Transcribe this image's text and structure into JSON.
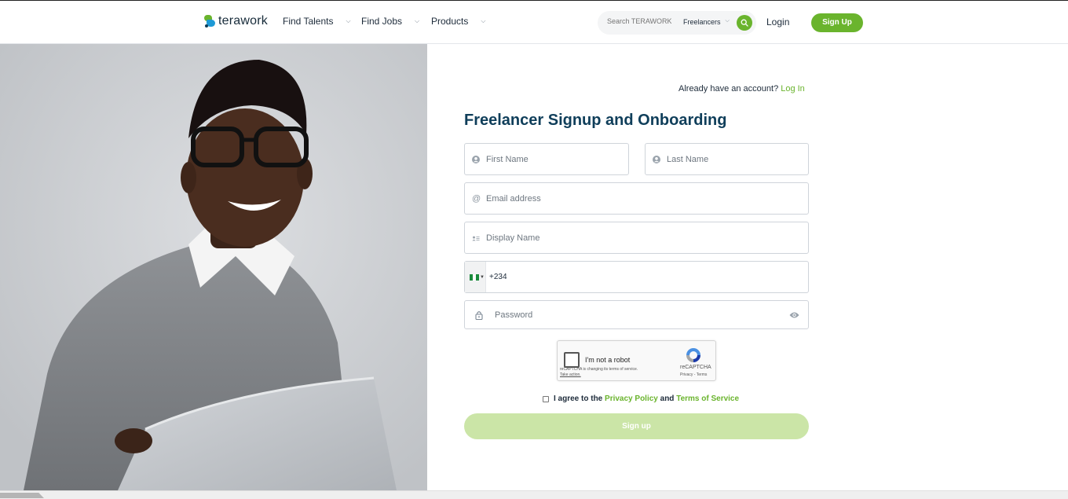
{
  "header": {
    "logo_text": "terawork",
    "nav": [
      {
        "label": "Find Talents"
      },
      {
        "label": "Find Jobs"
      },
      {
        "label": "Products"
      }
    ],
    "search": {
      "placeholder": "Search TERAWORK",
      "filter_value": "Freelancers"
    },
    "login_label": "Login",
    "signup_label": "Sign Up"
  },
  "form": {
    "have_account_text": "Already have an account?",
    "login_link": "Log In",
    "title": "Freelancer Signup and Onboarding",
    "first_name_placeholder": "First Name",
    "last_name_placeholder": "Last Name",
    "email_placeholder": "Email address",
    "display_name_placeholder": "Display Name",
    "phone_value": "+234",
    "password_placeholder": "Password",
    "captcha": {
      "label": "I'm not a robot",
      "notice": "reCAPTCHA is changing its terms of service.",
      "action": "Take action.",
      "brand": "reCAPTCHA",
      "links": "Privacy - Terms"
    },
    "agree": {
      "prefix": "I agree to the",
      "privacy": "Privacy Policy",
      "and": "and",
      "terms": "Terms of Service"
    },
    "submit_label": "Sign up"
  },
  "colors": {
    "brand_green": "#6ab42d",
    "title_navy": "#0f3e5a",
    "submit_disabled": "#cbe5a7"
  },
  "icons": [
    "terawork-logo-icon",
    "chevron-down-icon",
    "search-icon",
    "user-icon",
    "at-icon",
    "id-card-icon",
    "nigeria-flag-icon",
    "lock-icon",
    "eye-icon",
    "recaptcha-icon"
  ]
}
